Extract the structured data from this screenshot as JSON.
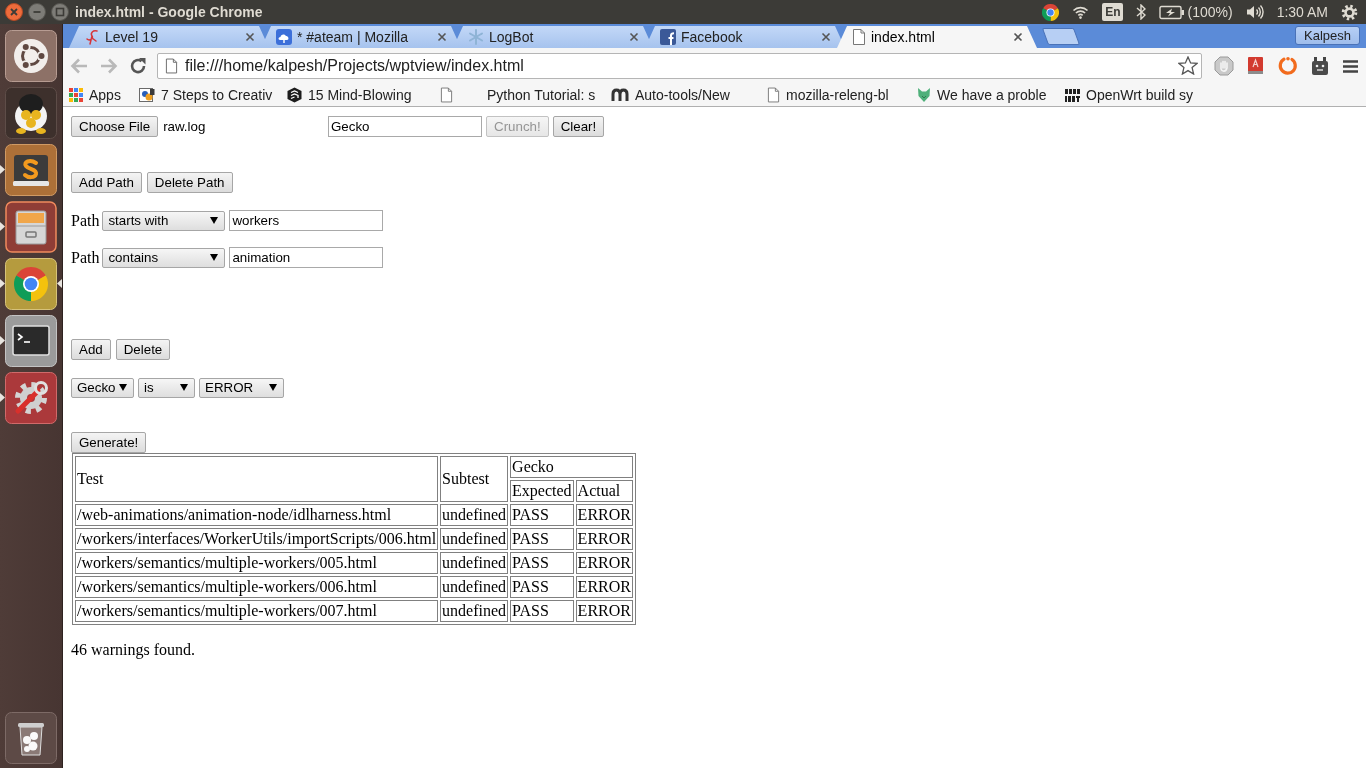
{
  "top_panel": {
    "window_title": "index.html - Google Chrome",
    "keyboard_layout": "En",
    "battery": "(100%)",
    "clock": "1:30 AM"
  },
  "launcher": {
    "items": [
      {
        "running": false,
        "focused": false
      },
      {
        "running": false,
        "focused": false
      },
      {
        "running": true,
        "focused": false
      },
      {
        "running": true,
        "focused": false
      },
      {
        "running": true,
        "focused": true
      },
      {
        "running": true,
        "focused": false
      },
      {
        "running": true,
        "focused": false
      },
      {
        "running": false,
        "focused": false
      }
    ]
  },
  "tabs": [
    {
      "title": "Level 19",
      "selected": false
    },
    {
      "title": "* #ateam | Mozilla",
      "selected": false
    },
    {
      "title": "LogBot",
      "selected": false
    },
    {
      "title": "Facebook",
      "selected": false
    },
    {
      "title": "index.html",
      "selected": true
    }
  ],
  "profile": {
    "name": "Kalpesh"
  },
  "toolbar": {
    "back": {
      "disabled": true
    },
    "forward": {
      "disabled": true
    },
    "address": "file:///home/kalpesh/Projects/wptview/index.html"
  },
  "bookmarks": [
    {
      "label": "Apps"
    },
    {
      "label": "7 Steps to Creativ"
    },
    {
      "label": "15 Mind-Blowing"
    },
    {
      "label": "Python Tutorial: s"
    },
    {
      "label": "Auto-tools/New"
    },
    {
      "label": "mozilla-releng-bl"
    },
    {
      "label": "We have a proble"
    },
    {
      "label": "OpenWrt build sy"
    }
  ],
  "page": {
    "file_input": {
      "button": "Choose File",
      "file_name": "raw.log"
    },
    "browser_field": {
      "value": "Gecko"
    },
    "top_buttons": [
      {
        "label": "Crunch!",
        "disabled": true
      },
      {
        "label": "Clear!",
        "disabled": false
      }
    ],
    "path_buttons": [
      "Add Path",
      "Delete Path"
    ],
    "path_filters": [
      {
        "label": "Path",
        "operator": "starts with",
        "value": "workers"
      },
      {
        "label": "Path",
        "operator": "contains",
        "value": "animation"
      }
    ],
    "result_buttons": [
      "Add",
      "Delete"
    ],
    "result_filters": [
      {
        "selects": [
          "Gecko",
          "is",
          "ERROR"
        ]
      }
    ],
    "generate_button": "Generate!",
    "results_table": {
      "columns": {
        "test": "Test",
        "subtest": "Subtest",
        "group": "Gecko",
        "expected": "Expected",
        "actual": "Actual"
      },
      "rows": [
        {
          "test": "/web-animations/animation-node/idlharness.html",
          "subtest": "undefined",
          "expected": "PASS",
          "actual": "ERROR"
        },
        {
          "test": "/workers/interfaces/WorkerUtils/importScripts/006.html",
          "subtest": "undefined",
          "expected": "PASS",
          "actual": "ERROR"
        },
        {
          "test": "/workers/semantics/multiple-workers/005.html",
          "subtest": "undefined",
          "expected": "PASS",
          "actual": "ERROR"
        },
        {
          "test": "/workers/semantics/multiple-workers/006.html",
          "subtest": "undefined",
          "expected": "PASS",
          "actual": "ERROR"
        },
        {
          "test": "/workers/semantics/multiple-workers/007.html",
          "subtest": "undefined",
          "expected": "PASS",
          "actual": "ERROR"
        }
      ]
    },
    "summary": "46 warnings found."
  }
}
